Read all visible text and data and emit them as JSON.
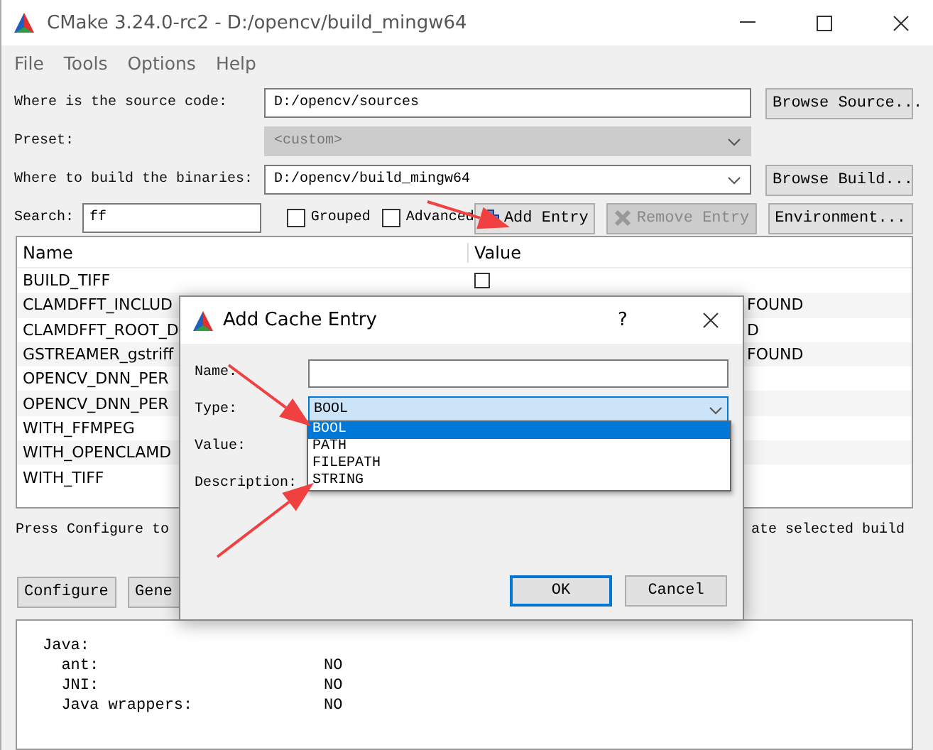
{
  "window": {
    "title": "CMake 3.24.0-rc2 - D:/opencv/build_mingw64"
  },
  "menu": [
    "File",
    "Tools",
    "Options",
    "Help"
  ],
  "paths": [
    {
      "label": "Where is the source code:",
      "value": "D:/opencv/sources",
      "kind": "text",
      "disabled": false,
      "button": "Browse Source..."
    },
    {
      "label": "Preset:",
      "value": "<custom>",
      "kind": "combo",
      "disabled": true
    },
    {
      "label": "Where to build the binaries:",
      "value": "D:/opencv/build_mingw64",
      "kind": "combo",
      "disabled": false,
      "button": "Browse Build..."
    }
  ],
  "search": {
    "label": "Search:",
    "value": "ff"
  },
  "options": [
    {
      "label": "Grouped",
      "checked": false
    },
    {
      "label": "Advanced",
      "checked": false
    }
  ],
  "toolbar": [
    {
      "label": "Add Entry",
      "kind": "add",
      "disabled": false
    },
    {
      "label": "Remove Entry",
      "kind": "remove",
      "disabled": true
    },
    {
      "label": "Environment...",
      "kind": "plain",
      "disabled": false
    }
  ],
  "table": {
    "columns": [
      "Name",
      "Value"
    ],
    "rows": [
      {
        "name": "BUILD_TIFF",
        "checked": false,
        "kind": "check"
      },
      {
        "name": "CLAMDFFT_INCLUD",
        "value": "FOUND",
        "kind": "text"
      },
      {
        "name": "CLAMDFFT_ROOT_D",
        "value": "D",
        "kind": "text"
      },
      {
        "name": "GSTREAMER_gstriff",
        "value": "FOUND",
        "kind": "text"
      },
      {
        "name": "OPENCV_DNN_PER",
        "kind": "text"
      },
      {
        "name": "OPENCV_DNN_PER",
        "kind": "text"
      },
      {
        "name": "WITH_FFMPEG",
        "kind": "text"
      },
      {
        "name": "WITH_OPENCLAMD",
        "kind": "text"
      },
      {
        "name": "WITH_TIFF",
        "kind": "text"
      }
    ]
  },
  "status": {
    "left": "Press Configure to",
    "right": "ate selected build"
  },
  "actions": [
    "Configure",
    "Gene"
  ],
  "output": [
    "Java:",
    "  ant:                        NO",
    "  JNI:                        NO",
    "  Java wrappers:              NO"
  ],
  "dialog": {
    "title": "Add Cache Entry",
    "help": "?",
    "fields": [
      {
        "label": "Name:",
        "kind": "text"
      },
      {
        "label": "Type:",
        "kind": "combo",
        "value": "BOOL"
      },
      {
        "label": "Value:",
        "kind": "text"
      },
      {
        "label": "Description:",
        "kind": "text"
      }
    ],
    "type_options": [
      {
        "label": "BOOL",
        "selected": true
      },
      {
        "label": "PATH",
        "selected": false
      },
      {
        "label": "FILEPATH",
        "selected": false
      },
      {
        "label": "STRING",
        "selected": false
      }
    ],
    "buttons": [
      {
        "label": "OK",
        "default": true
      },
      {
        "label": "Cancel",
        "default": false
      }
    ]
  }
}
